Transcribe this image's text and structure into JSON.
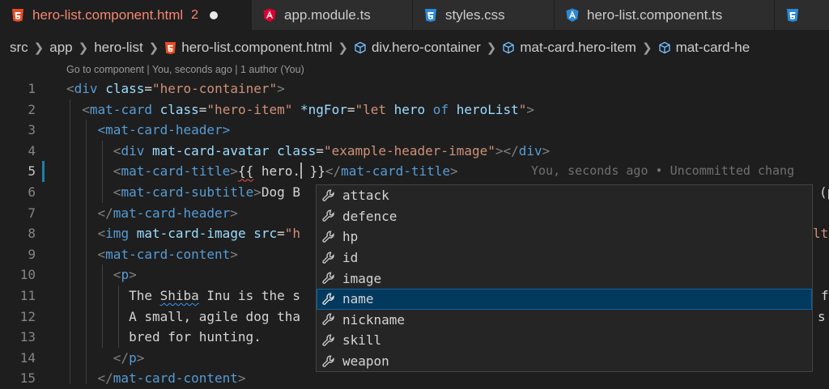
{
  "tabs": [
    {
      "label": "hero-list.component.html",
      "dirty_count": "2",
      "icon": "html5-icon"
    },
    {
      "label": "app.module.ts",
      "icon": "angular-icon"
    },
    {
      "label": "styles.css",
      "icon": "css3-icon"
    },
    {
      "label": "hero-list.component.ts",
      "icon": "angular-icon"
    },
    {
      "label": "",
      "icon": "html5-icon"
    }
  ],
  "breadcrumb": [
    "src",
    "app",
    "hero-list",
    "hero-list.component.html",
    "div.hero-container",
    "mat-card.hero-item",
    "mat-card-he"
  ],
  "codelens": "Go to component | You, seconds ago | 1 author (You)",
  "line_numbers": [
    "1",
    "2",
    "3",
    "4",
    "5",
    "6",
    "7",
    "8",
    "9",
    "10",
    "11",
    "12",
    "13",
    "14",
    "15"
  ],
  "code": {
    "l1": {
      "open": "<",
      "tag": "div",
      "sp": " ",
      "attr": "class",
      "eq": "=",
      "val": "\"hero-container\"",
      "close": ">"
    },
    "l2": {
      "open": "<",
      "tag": "mat-card",
      "attr1": "class",
      "val1": "\"hero-item\"",
      "attr2": "*ngFor",
      "val2": "\"let ",
      "v2b": "hero",
      "v2c": " of ",
      "v2d": "heroList",
      "v2e": "\"",
      "close": ">"
    },
    "l3": {
      "tag": "<mat-card-header>"
    },
    "l4": {
      "open": "<",
      "tag": "div",
      "attr1": "mat-card-avatar",
      "attr2": "class",
      "val": "\"example-header-image\"",
      "mid": "></",
      "tag2": "div",
      "close": ">"
    },
    "l5": {
      "open": "<",
      "tag": "mat-card-title",
      "close": ">",
      "interp_open": "{{",
      "expr": " hero.",
      "interp_close": "}}",
      "end_open": "</",
      "end_tag": "mat-card-title",
      "end_close": ">"
    },
    "l6": {
      "open": "<",
      "tag": "mat-card-subtitle",
      "close": ">",
      "text": "Dog B",
      "tail": "(p"
    },
    "l7": {
      "open": "</",
      "tag": "mat-card-header",
      "close": ">"
    },
    "l8": {
      "open": "<",
      "tag": "img",
      "attr1": "mat-card-image",
      "attr2": "src",
      "val": "\"h",
      "tail": "lt"
    },
    "l9": {
      "open": "<",
      "tag": "mat-card-content",
      "close": ">"
    },
    "l10": {
      "open": "<",
      "tag": "p",
      "close": ">"
    },
    "l11": {
      "pre": "The ",
      "word": "Shiba",
      "post": " Inu is the s",
      "tail": "f"
    },
    "l12": {
      "text": "A small, agile dog tha",
      "tail": "s"
    },
    "l13": {
      "text": "bred for hunting."
    },
    "l14": {
      "open": "</",
      "tag": "p",
      "close": ">"
    },
    "l15": {
      "open": "</",
      "tag": "mat-card-content",
      "close": ">"
    }
  },
  "blame": "You, seconds ago • Uncommitted chang",
  "suggestions": [
    "attack",
    "defence",
    "hp",
    "id",
    "image",
    "name",
    "nickname",
    "skill",
    "weapon"
  ],
  "selected_suggestion": "name",
  "colors": {
    "tag": "#569cd6",
    "attribute": "#9cdcfe",
    "string": "#ce9178",
    "active_tab_text": "#f48771",
    "selection": "#04395e"
  }
}
